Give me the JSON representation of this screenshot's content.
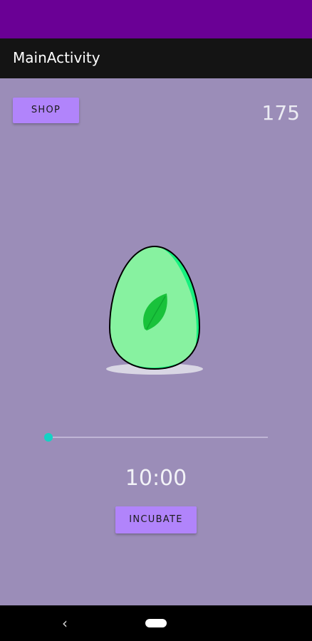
{
  "app": {
    "title": "MainActivity"
  },
  "header": {
    "shop_label": "SHOP",
    "coins": "175"
  },
  "egg": {
    "icon": "leaf-egg-icon",
    "colors": {
      "shell": "#87f2a0",
      "shell_shade": "#18f07f",
      "leaf": "#19c23b",
      "outline": "#000000",
      "shadow": "#d9d6e4"
    }
  },
  "timer": {
    "slider_value_fraction": 0,
    "display": "10:00",
    "incubate_label": "INCUBATE"
  },
  "navigation": {
    "back_glyph": "‹",
    "back_icon": "back-icon",
    "home_icon": "home-pill-icon"
  },
  "colors": {
    "status_bar": "#6a0095",
    "app_bar": "#141414",
    "background": "#9b8db8",
    "button": "#b184fb",
    "slider_thumb": "#14d2c4"
  }
}
